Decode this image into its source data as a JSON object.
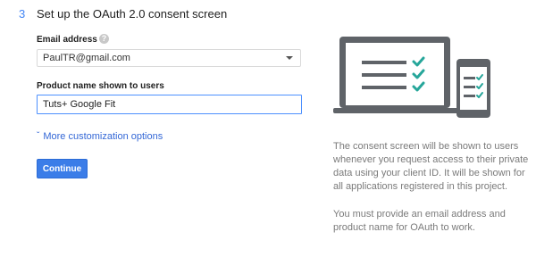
{
  "step": {
    "number": "3",
    "title": "Set up the OAuth 2.0 consent screen"
  },
  "form": {
    "email_label": "Email address",
    "email_help_icon": "help-circle-icon",
    "email_selected": "PaulTR@gmail.com",
    "product_label": "Product name shown to users",
    "product_value": "Tuts+ Google Fit",
    "more_options_label": "More customization options",
    "more_options_icon": "chevron-down-icon",
    "continue_label": "Continue"
  },
  "info": {
    "paragraph1": "The consent screen will be shown to users whenever you request access to their private data using your client ID. It will be shown for all applications registered in this project.",
    "paragraph2": "You must provide an email address and product name for OAuth to work."
  },
  "colors": {
    "accent_blue": "#4285f4",
    "button_blue": "#3b7de8",
    "check_teal": "#26a69a",
    "device_gray": "#5f6368"
  }
}
